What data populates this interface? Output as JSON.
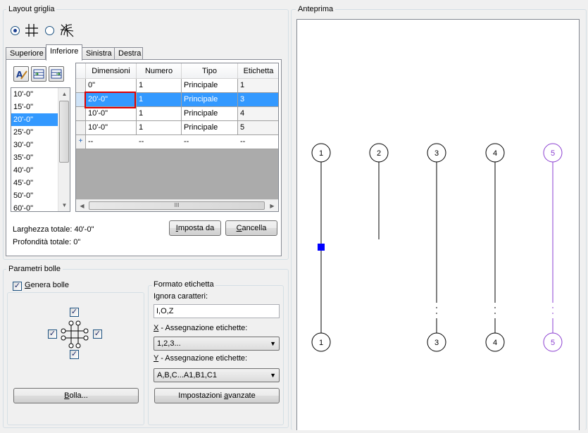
{
  "layout_group": {
    "title": "Layout griglia"
  },
  "layout_modes": [
    {
      "name": "rectangular-grid-icon",
      "selected": true
    },
    {
      "name": "radial-grid-icon",
      "selected": false
    }
  ],
  "tabs": [
    {
      "label": "Superiore",
      "active": false
    },
    {
      "label": "Inferiore",
      "active": true
    },
    {
      "label": "Sinistra",
      "active": false
    },
    {
      "label": "Destra",
      "active": false
    }
  ],
  "toolbar_icons": [
    "edit-label-icon",
    "insert-row-icon",
    "append-row-icon"
  ],
  "spacing_list": {
    "items": [
      "10'-0\"",
      "15'-0\"",
      "20'-0\"",
      "25'-0\"",
      "30'-0\"",
      "35'-0\"",
      "40'-0\"",
      "45'-0\"",
      "50'-0\"",
      "60'-0\""
    ],
    "selected_index": 2
  },
  "grid_table": {
    "columns": [
      "Dimensioni",
      "Numero",
      "Tipo",
      "Etichetta"
    ],
    "rows": [
      [
        "0\"",
        "1",
        "Principale",
        "1"
      ],
      [
        "20'-0\"",
        "1",
        "Principale",
        "3"
      ],
      [
        "10'-0\"",
        "1",
        "Principale",
        "4"
      ],
      [
        "10'-0\"",
        "1",
        "Principale",
        "5"
      ]
    ],
    "new_row": [
      "--",
      "--",
      "--",
      "--"
    ],
    "new_row_marker": "+",
    "selected_row": 1,
    "hscroll_grip": "III"
  },
  "totals": {
    "width_label": "Larghezza totale: 40'-0\"",
    "depth_label": "Profondità totale: 0\""
  },
  "buttons": {
    "imposta_da": {
      "pre": "",
      "ul": "I",
      "post": "mposta da"
    },
    "cancella": {
      "pre": "",
      "ul": "C",
      "post": "ancella"
    },
    "bolla": {
      "pre": "",
      "ul": "B",
      "post": "olla..."
    },
    "advanced": {
      "pre": "Impostazioni ",
      "ul": "a",
      "post": "vanzate"
    }
  },
  "bubble_group": {
    "title": "Parametri bolle",
    "generate_label_ul": "G",
    "generate_label_rest": "enera bolle",
    "generate_checked": true,
    "positions": {
      "top": true,
      "left": true,
      "right": true,
      "bottom": true
    }
  },
  "label_format": {
    "title": "Formato etichetta",
    "ignore_chars_label": "Ignora caratteri:",
    "ignore_chars_value": "I,O,Z",
    "x_assign_ul": "X",
    "x_assign_rest": " - Assegnazione etichette:",
    "x_assign_value": "1,2,3...",
    "y_assign_ul": "Y",
    "y_assign_rest": " - Assegnazione etichette:",
    "y_assign_value": "A,B,C...A1,B1,C1"
  },
  "preview": {
    "title": "Anteprima",
    "top_bubbles": [
      "1",
      "2",
      "3",
      "4",
      "5"
    ],
    "bottom_bubbles": [
      "1",
      "3",
      "4",
      "5"
    ],
    "line_color": "#000000",
    "highlight_color": "#8b3fd1",
    "marker_color": "#0000ff"
  },
  "colors": {
    "selection": "#3399ff",
    "highlight_box": "#e00000"
  }
}
